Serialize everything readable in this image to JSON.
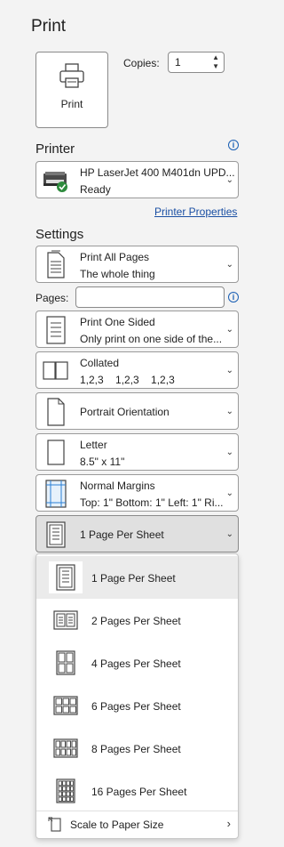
{
  "title": "Print",
  "print_button": {
    "label": "Print"
  },
  "copies": {
    "label": "Copies:",
    "value": "1"
  },
  "printer": {
    "heading": "Printer",
    "name": "HP LaserJet 400 M401dn UPD...",
    "status": "Ready",
    "properties_link": "Printer Properties"
  },
  "settings": {
    "heading": "Settings",
    "print_range": {
      "line1": "Print All Pages",
      "line2": "The whole thing"
    },
    "pages_label": "Pages:",
    "pages_value": "",
    "sides": {
      "line1": "Print One Sided",
      "line2": "Only print on one side of the..."
    },
    "collation": {
      "line1": "Collated",
      "line2": "1,2,3    1,2,3    1,2,3"
    },
    "orientation": {
      "line1": "Portrait Orientation"
    },
    "paper": {
      "line1": "Letter",
      "line2": "8.5\" x 11\""
    },
    "margins": {
      "line1": "Normal Margins",
      "line2": "Top: 1\" Bottom: 1\" Left: 1\" Ri..."
    },
    "pages_per_sheet": {
      "line1": "1 Page Per Sheet"
    }
  },
  "pages_per_sheet_menu": {
    "items": [
      {
        "label": "1 Page Per Sheet",
        "icon": "one-page-icon",
        "selected": true
      },
      {
        "label": "2 Pages Per Sheet",
        "icon": "two-pages-icon"
      },
      {
        "label": "4 Pages Per Sheet",
        "icon": "four-pages-icon"
      },
      {
        "label": "6 Pages Per Sheet",
        "icon": "six-pages-icon"
      },
      {
        "label": "8 Pages Per Sheet",
        "icon": "eight-pages-icon"
      },
      {
        "label": "16 Pages Per Sheet",
        "icon": "sixteen-pages-icon"
      }
    ],
    "scale": {
      "label": "Scale to Paper Size"
    }
  },
  "colors": {
    "accent": "#1a4fa3",
    "ready_green": "#2e8b3d",
    "background": "#f3f3f3"
  }
}
